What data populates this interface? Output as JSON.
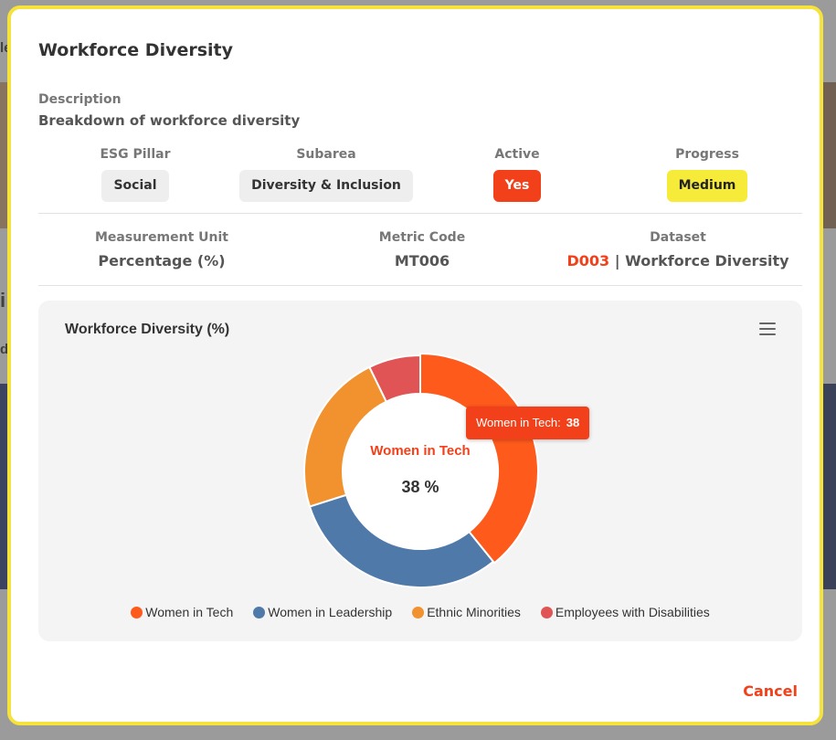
{
  "modal": {
    "title": "Workforce Diversity",
    "description_label": "Description",
    "description_value": "Breakdown of workforce diversity",
    "esg_pillar_label": "ESG Pillar",
    "esg_pillar_value": "Social",
    "subarea_label": "Subarea",
    "subarea_value": "Diversity & Inclusion",
    "active_label": "Active",
    "active_value": "Yes",
    "progress_label": "Progress",
    "progress_value": "Medium",
    "unit_label": "Measurement Unit",
    "unit_value": "Percentage (%)",
    "metric_code_label": "Metric Code",
    "metric_code_value": "MT006",
    "dataset_label": "Dataset",
    "dataset_code": "D003",
    "dataset_separator": "|",
    "dataset_name": "Workforce Diversity",
    "cancel_label": "Cancel"
  },
  "colors": {
    "accent": "#f2401a",
    "progress_medium": "#f7eb3a",
    "modal_border": "#f5e23a"
  },
  "chart": {
    "menu_icon": "hamburger-menu-icon",
    "tooltip_label": "Women in Tech:",
    "tooltip_value": "38",
    "center_label": "Women in Tech",
    "center_value": "38 %"
  },
  "chart_data": {
    "type": "pie",
    "title": "Workforce Diversity (%)",
    "donut": true,
    "categories": [
      "Women in Tech",
      "Women in Leadership",
      "Ethnic Minorities",
      "Employees with Disabilities"
    ],
    "values": [
      38,
      30,
      22,
      7
    ],
    "colors": [
      "#fe5a1c",
      "#4f79a8",
      "#f1922f",
      "#e05456"
    ],
    "legend_position": "bottom",
    "highlighted": "Women in Tech"
  },
  "background": {
    "partial_texts": [
      "le",
      "i",
      "d"
    ]
  }
}
